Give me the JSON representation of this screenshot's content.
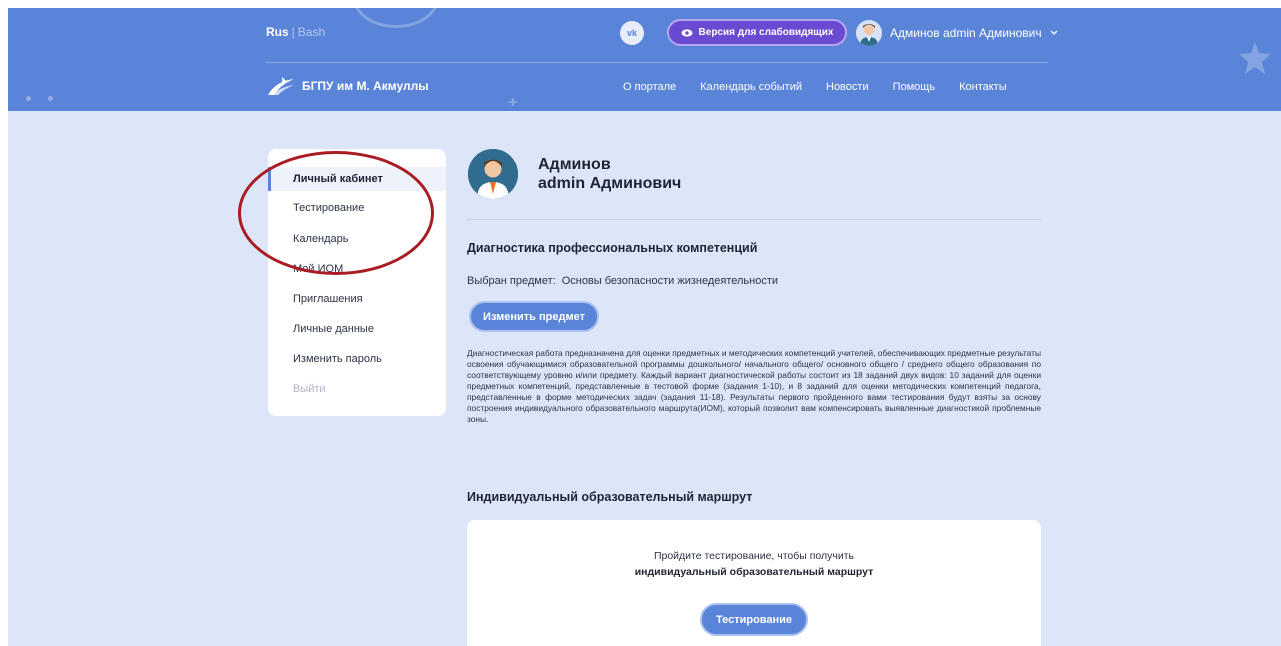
{
  "header": {
    "lang_active": "Rus",
    "lang_sep": "|",
    "lang_other": "Bash",
    "vk_label": "vk",
    "accessibility_label": "Версия для слабовидящих",
    "user_name": "Админов admin Админович",
    "logo_text": "БГПУ им М. Акмуллы",
    "nav": [
      "О портале",
      "Календарь событий",
      "Новости",
      "Помощь",
      "Контакты"
    ]
  },
  "sidebar": {
    "items": [
      "Личный кабинет",
      "Тестирование",
      "Календарь",
      "Мой ИОМ",
      "Приглашения",
      "Личные данные",
      "Изменить пароль",
      "Выйти"
    ]
  },
  "profile": {
    "last_name": "Админов",
    "first_names": "admin Админович"
  },
  "diagnostics": {
    "title": "Диагностика профессиональных компетенций",
    "subject_label": "Выбран предмет:",
    "subject_value": "Основы безопасности жизнедеятельности",
    "change_button": "Изменить предмет",
    "description": "Диагностическая работа предназначена для оценки предметных и методических компетенций учителей, обеспечивающих предметные результаты освоения обучающимися образовательной программы дошкольного/ начального общего/ основного общего / среднего общего образования по соответствующему уровню и/или предмету. Каждый вариант диагностической работы состоит из 18 заданий двух видов: 10 заданий для оценки предметных компетенций, представленные в тестовой форме (задания 1-10), и 8 заданий для оценки методических компетенций педагога, представленные в форме методических задач (задания 11-18). Результаты первого пройденного вами тестирования будут взяты за основу построения индивидуального образовательного маршрута(ИОМ), который позволит вам компенсировать выявленные диагностикой проблемные зоны."
  },
  "iom": {
    "title": "Индивидуальный образовательный маршрут",
    "prompt": "Пройдите тестирование, чтобы получить",
    "prompt_bold": "индивидуальный образовательный маршрут",
    "button": "Тестирование"
  },
  "colors": {
    "header_bg": "#5a84d8",
    "page_bg": "#dde6f8",
    "accessibility_bg": "#6a4ad0",
    "annotation": "#a91c23"
  }
}
